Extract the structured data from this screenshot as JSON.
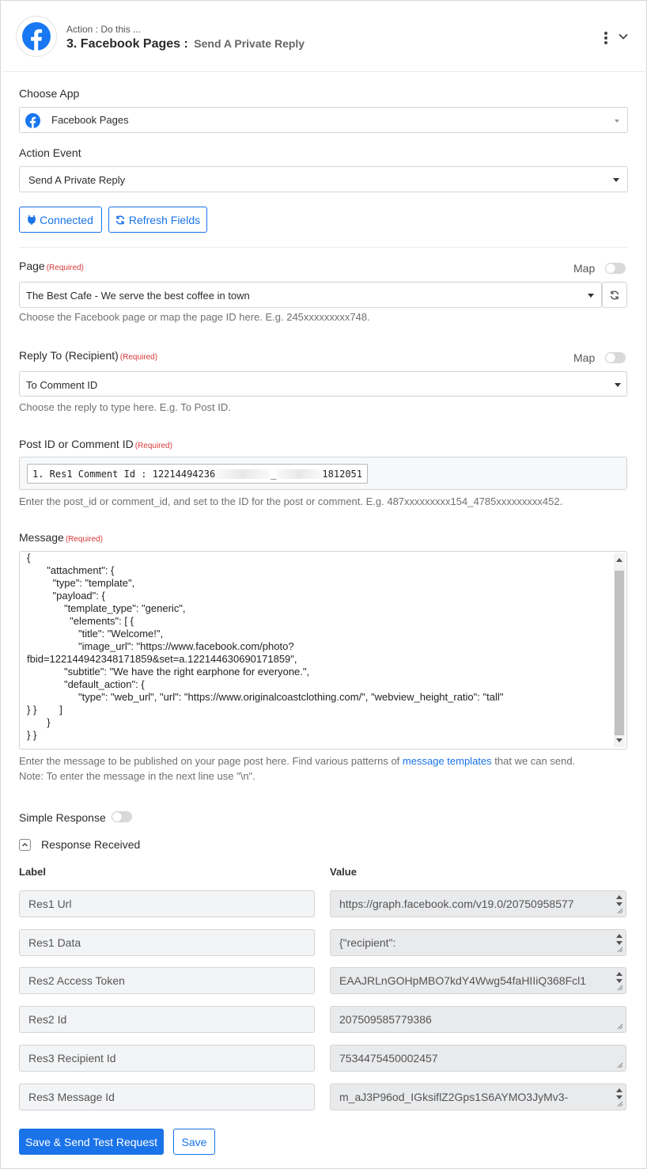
{
  "header": {
    "subtitle": "Action : Do this ...",
    "step_title": "3. Facebook Pages :",
    "event_name": "Send A Private Reply"
  },
  "choose_app": {
    "label": "Choose App",
    "value": "Facebook Pages"
  },
  "action_event": {
    "label": "Action Event",
    "value": "Send A Private Reply"
  },
  "buttons": {
    "connected": "Connected",
    "refresh_fields": "Refresh Fields",
    "save_send": "Save & Send Test Request",
    "save": "Save"
  },
  "page_field": {
    "label": "Page",
    "required": "(Required)",
    "map_label": "Map",
    "value": "The Best Cafe - We serve the best coffee in town",
    "help": "Choose the Facebook page or map the page ID here. E.g. 245xxxxxxxxx748."
  },
  "reply_to": {
    "label": "Reply To (Recipient)",
    "required": "(Required)",
    "map_label": "Map",
    "value": "To Comment ID",
    "help": "Choose the reply to type here. E.g. To Post ID."
  },
  "post_id": {
    "label": "Post ID or Comment ID",
    "required": "(Required)",
    "chip_prefix": "1. Res1 Comment Id : 12214494236",
    "chip_mid": "_",
    "chip_suffix": "1812051",
    "help": "Enter the post_id or comment_id, and set to the ID for the post or comment. E.g. 487xxxxxxxxx154_4785xxxxxxxxx452."
  },
  "message": {
    "label": "Message",
    "required": "(Required)",
    "body": "{\n       \"attachment\": {\n         \"type\": \"template\",\n         \"payload\": {\n             \"template_type\": \"generic\",\n               \"elements\": [ {\n                  \"title\": \"Welcome!\",\n                  \"image_url\": \"https://www.facebook.com/photo?\nfbid=122144942348171859&set=a.122144630690171859\",\n             \"subtitle\": \"We have the right earphone for everyone.\",\n             \"default_action\": {\n                  \"type\": \"web_url\", \"url\": \"https://www.originalcoastclothing.com/\", \"webview_height_ratio\": \"tall\"\n} }        ]\n       }\n} }",
    "help_prefix": "Enter the message to be published on your page post here. Find various patterns of ",
    "help_link": "message templates",
    "help_suffix": " that we can send.",
    "help_line2": "Note: To enter the message in the next line use \"\\n\"."
  },
  "simple_response": {
    "label": "Simple Response"
  },
  "response_received": {
    "label": "Response Received",
    "col_label": "Label",
    "col_value": "Value",
    "rows": [
      {
        "label": "Res1 Url",
        "value": "https://graph.facebook.com/v19.0/20750958577"
      },
      {
        "label": "Res1 Data",
        "value": "{\"recipient\":"
      },
      {
        "label": "Res2 Access Token",
        "value": "EAAJRLnGOHpMBO7kdY4Wwg54faHIIiQ368Fcl1"
      },
      {
        "label": "Res2 Id",
        "value": "207509585779386"
      },
      {
        "label": "Res3 Recipient Id",
        "value": "7534475450002457"
      },
      {
        "label": "Res3 Message Id",
        "value": "m_aJ3P96od_IGksiflZ2Gps1S6AYMO3JyMv3-"
      }
    ]
  },
  "colors": {
    "accent": "#1a73e8",
    "required": "#d9383a",
    "facebook": "#1877f2"
  }
}
